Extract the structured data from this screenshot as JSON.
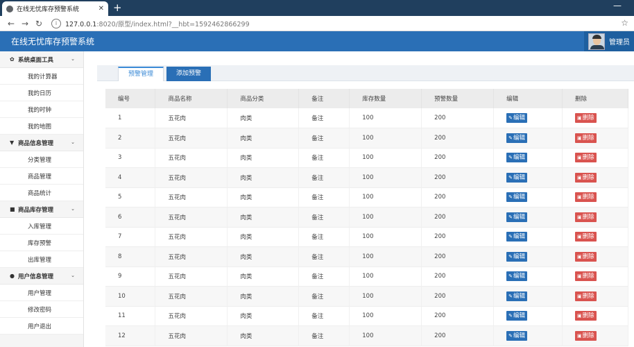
{
  "browser": {
    "tab_title": "在线无忧库存预警系统",
    "new_tab": "+",
    "url_host": "127.0.0.1",
    "url_rest": ":8020/原型/index.html?__hbt=1592462866299"
  },
  "header": {
    "title": "在线无忧库存预警系统",
    "user": "管理员"
  },
  "sidebar": {
    "groups": [
      {
        "label": "系统桌面工具",
        "items": [
          "我的计算器",
          "我的日历",
          "我的时钟",
          "我的地图"
        ]
      },
      {
        "label": "商品信息管理",
        "items": [
          "分类管理",
          "商品管理",
          "商品统计"
        ]
      },
      {
        "label": "商品库存管理",
        "items": [
          "入库管理",
          "库存预警",
          "出库管理"
        ]
      },
      {
        "label": "用户信息管理",
        "items": [
          "用户管理",
          "修改密码",
          "用户退出"
        ]
      }
    ]
  },
  "tabs": {
    "active": "预警管理",
    "other": "添加预警"
  },
  "table": {
    "headers": [
      "编号",
      "商品名称",
      "商品分类",
      "备注",
      "库存数量",
      "预警数量",
      "编辑",
      "删除"
    ],
    "edit_label": "编辑",
    "delete_label": "删除",
    "rows": [
      [
        "1",
        "五花肉",
        "肉类",
        "备注",
        "100",
        "200"
      ],
      [
        "2",
        "五花肉",
        "肉类",
        "备注",
        "100",
        "200"
      ],
      [
        "3",
        "五花肉",
        "肉类",
        "备注",
        "100",
        "200"
      ],
      [
        "4",
        "五花肉",
        "肉类",
        "备注",
        "100",
        "200"
      ],
      [
        "5",
        "五花肉",
        "肉类",
        "备注",
        "100",
        "200"
      ],
      [
        "6",
        "五花肉",
        "肉类",
        "备注",
        "100",
        "200"
      ],
      [
        "7",
        "五花肉",
        "肉类",
        "备注",
        "100",
        "200"
      ],
      [
        "8",
        "五花肉",
        "肉类",
        "备注",
        "100",
        "200"
      ],
      [
        "9",
        "五花肉",
        "肉类",
        "备注",
        "100",
        "200"
      ],
      [
        "10",
        "五花肉",
        "肉类",
        "备注",
        "100",
        "200"
      ],
      [
        "11",
        "五花肉",
        "肉类",
        "备注",
        "100",
        "200"
      ],
      [
        "12",
        "五花肉",
        "肉类",
        "备注",
        "100",
        "200"
      ]
    ]
  }
}
